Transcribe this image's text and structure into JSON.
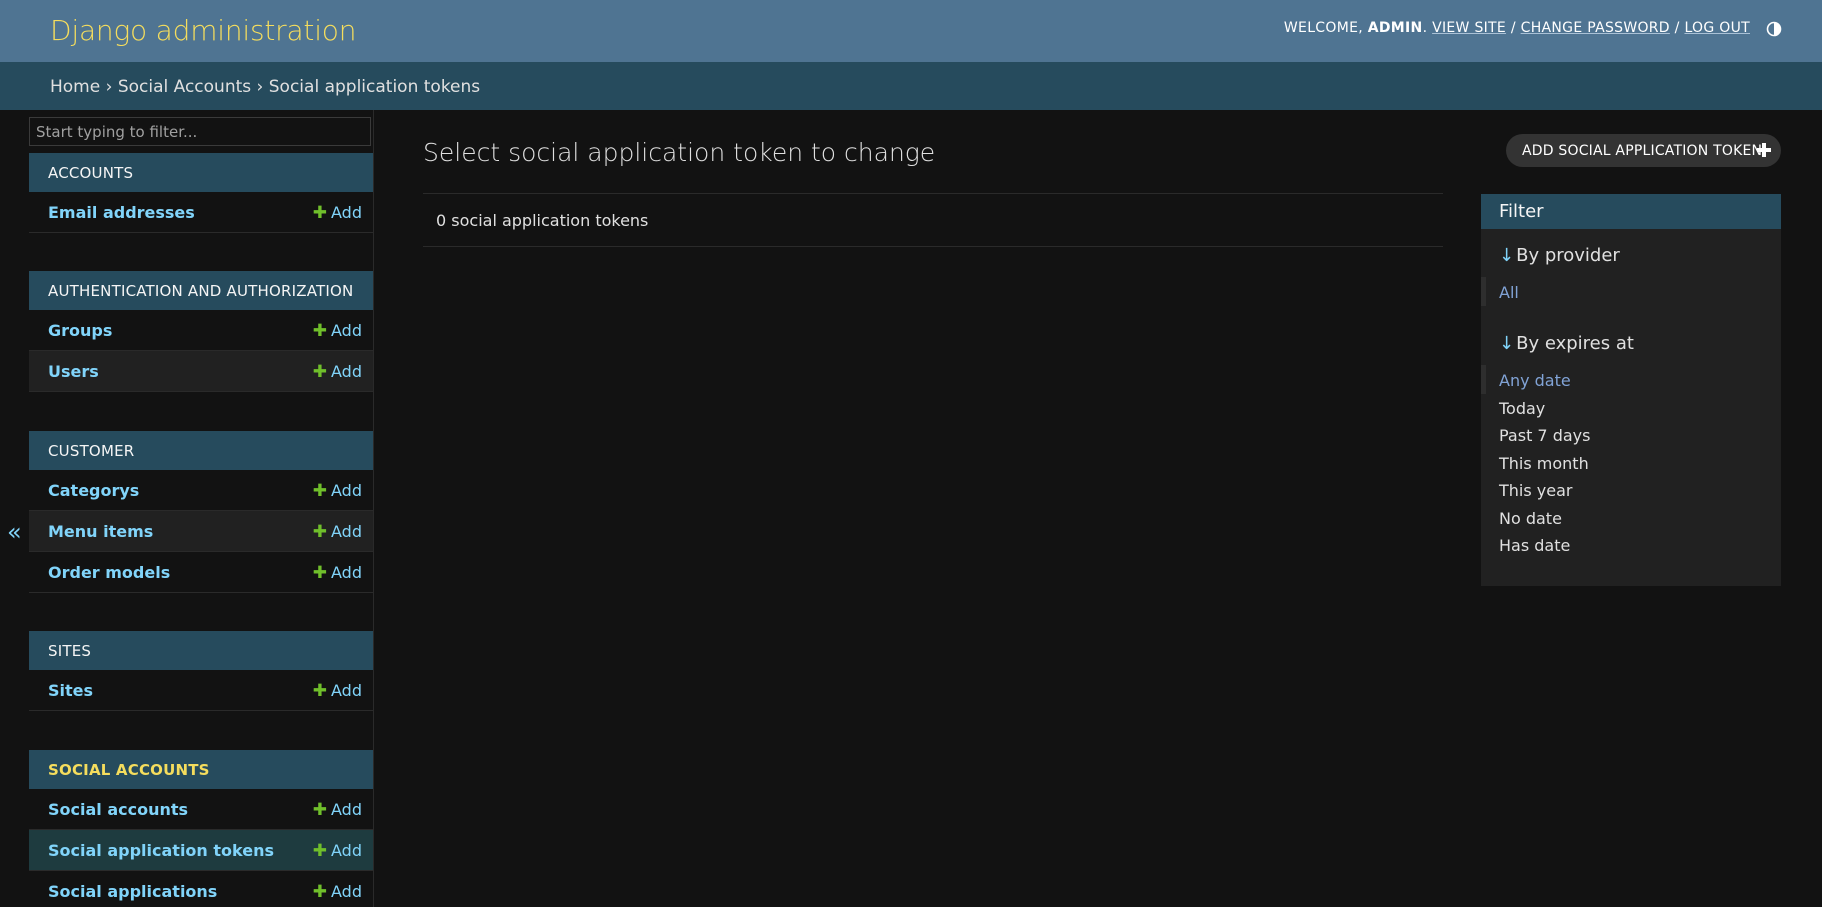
{
  "header": {
    "site_name": "Django administration",
    "welcome_text": "Welcome,",
    "username": "admin",
    "view_site": "View site",
    "change_password": "Change password",
    "log_out": "Log out",
    "theme_toggle_icon": "contrast-icon"
  },
  "breadcrumbs": {
    "home": "Home",
    "sep1": "›",
    "app": "Social Accounts",
    "sep2": "›",
    "current": "Social application tokens"
  },
  "sidebar": {
    "filter_placeholder": "Start typing to filter...",
    "collapse_icon": "«",
    "add_label": "Add",
    "apps": [
      {
        "name": "Accounts",
        "models": [
          "Email addresses"
        ]
      },
      {
        "name": "Authentication and Authorization",
        "models": [
          "Groups",
          "Users"
        ]
      },
      {
        "name": "Customer",
        "models": [
          "Categorys",
          "Menu items",
          "Order models"
        ]
      },
      {
        "name": "Sites",
        "models": [
          "Sites"
        ]
      },
      {
        "name": "Social Accounts",
        "models": [
          "Social accounts",
          "Social application tokens",
          "Social applications"
        ],
        "current": true
      }
    ]
  },
  "content": {
    "title": "Select social application token to change",
    "add_button": "Add social application token",
    "result_count": "0 social application tokens"
  },
  "filter": {
    "heading": "Filter",
    "arrow": "↓",
    "groups": [
      {
        "title": "By provider",
        "options": [
          "All"
        ],
        "selected": 0
      },
      {
        "title": "By expires at",
        "options": [
          "Any date",
          "Today",
          "Past 7 days",
          "This month",
          "This year",
          "No date",
          "Has date"
        ],
        "selected": 0
      }
    ]
  },
  "colors": {
    "header_bg": "#4f7492",
    "breadcrumb_bg": "#264b5d",
    "accent_yellow": "#f5dd5d",
    "link_blue": "#81d4fa",
    "add_green": "#70bf2b",
    "page_bg": "#121212"
  }
}
